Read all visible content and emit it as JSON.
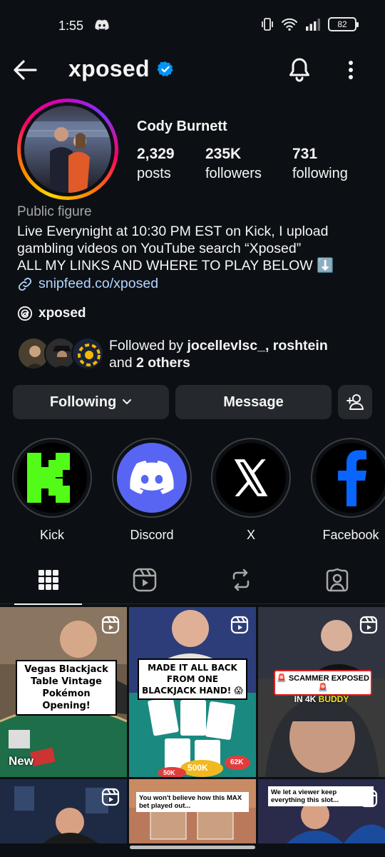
{
  "status_bar": {
    "time": "1:55",
    "battery": "82"
  },
  "header": {
    "username": "xposed"
  },
  "profile": {
    "full_name": "Cody Burnett",
    "stats": [
      {
        "value": "2,329",
        "label": "posts"
      },
      {
        "value": "235K",
        "label": "followers"
      },
      {
        "value": "731",
        "label": "following"
      }
    ],
    "category": "Public figure",
    "bio_lines": [
      "Live Everynight at 10:30 PM EST on Kick, I upload",
      "gambling videos on YouTube search “Xposed”",
      "ALL MY LINKS AND WHERE TO PLAY BELOW ⬇️"
    ],
    "link": "snipfeed.co/xposed",
    "threads_handle": "xposed",
    "followed_by": {
      "prefix": "Followed by ",
      "users": "jocellevlsc_, roshtein",
      "middle": "and ",
      "others": "2 others"
    }
  },
  "actions": {
    "following": "Following",
    "message": "Message"
  },
  "highlights": [
    {
      "label": "Kick"
    },
    {
      "label": "Discord"
    },
    {
      "label": "X"
    },
    {
      "label": "Facebook"
    }
  ],
  "posts": [
    {
      "caption": "Vegas Blackjack Table Vintage Pokémon Opening!",
      "badge": "New"
    },
    {
      "caption": "MADE IT ALL BACK FROM ONE BLACKJACK HAND! 😱",
      "chips": [
        "500K",
        "62K",
        "50K"
      ]
    },
    {
      "caption": "🚨 SCAMMER EXPOSED 🚨",
      "sub_white": "IN 4K ",
      "sub_yellow": "BUDDY"
    },
    {
      "caption": ""
    },
    {
      "caption": "You won't believe how this MAX bet played out..."
    },
    {
      "caption": "We let a viewer keep everything this slot..."
    }
  ],
  "colors": {
    "verified": "#0095f6",
    "kick": "#53fc18",
    "discord": "#5865f2",
    "facebook": "#0866ff",
    "link": "#b3d4ff"
  }
}
